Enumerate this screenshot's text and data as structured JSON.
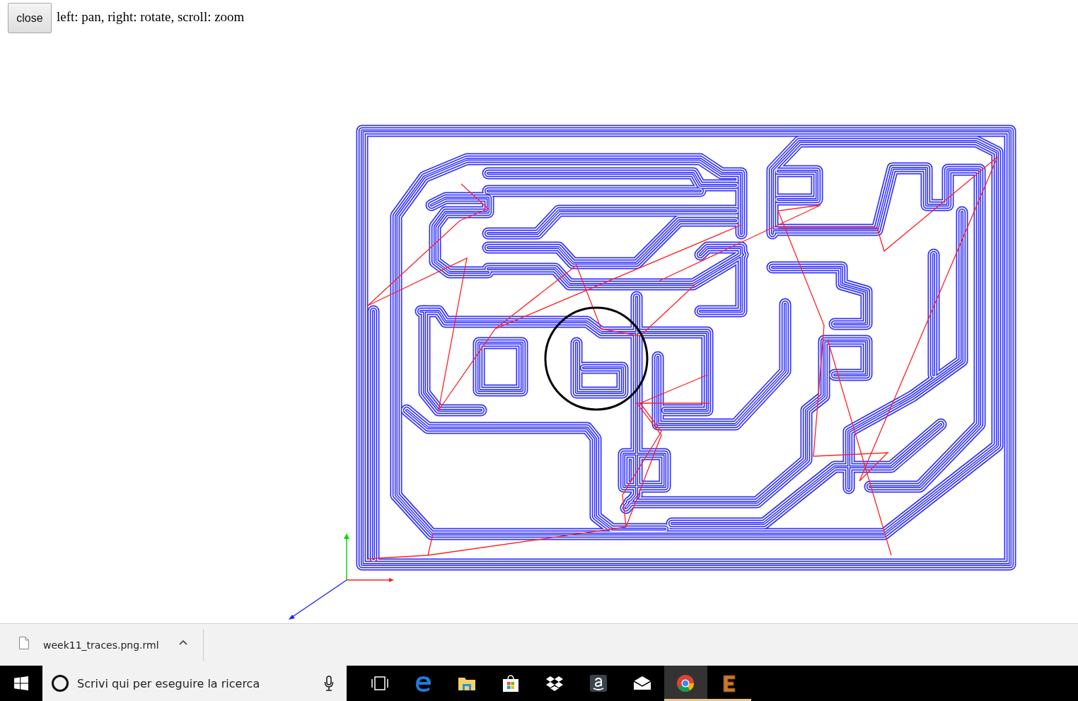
{
  "toolbar": {
    "close_button": "close",
    "hint": "left: pan, right: rotate, scroll: zoom"
  },
  "download_bar": {
    "items": [
      {
        "filename": "week11_traces.png.rml"
      }
    ]
  },
  "taskbar": {
    "search": {
      "placeholder": "Scrivi qui per eseguire la ricerca"
    },
    "apps": [
      {
        "running": false,
        "selected": false
      },
      {
        "running": false,
        "selected": false
      },
      {
        "running": false,
        "selected": false
      },
      {
        "running": false,
        "selected": false
      },
      {
        "running": false,
        "selected": false
      },
      {
        "running": false,
        "selected": false
      },
      {
        "running": false,
        "selected": false
      },
      {
        "running": true,
        "selected": true
      },
      {
        "running": true,
        "selected": false
      }
    ]
  }
}
